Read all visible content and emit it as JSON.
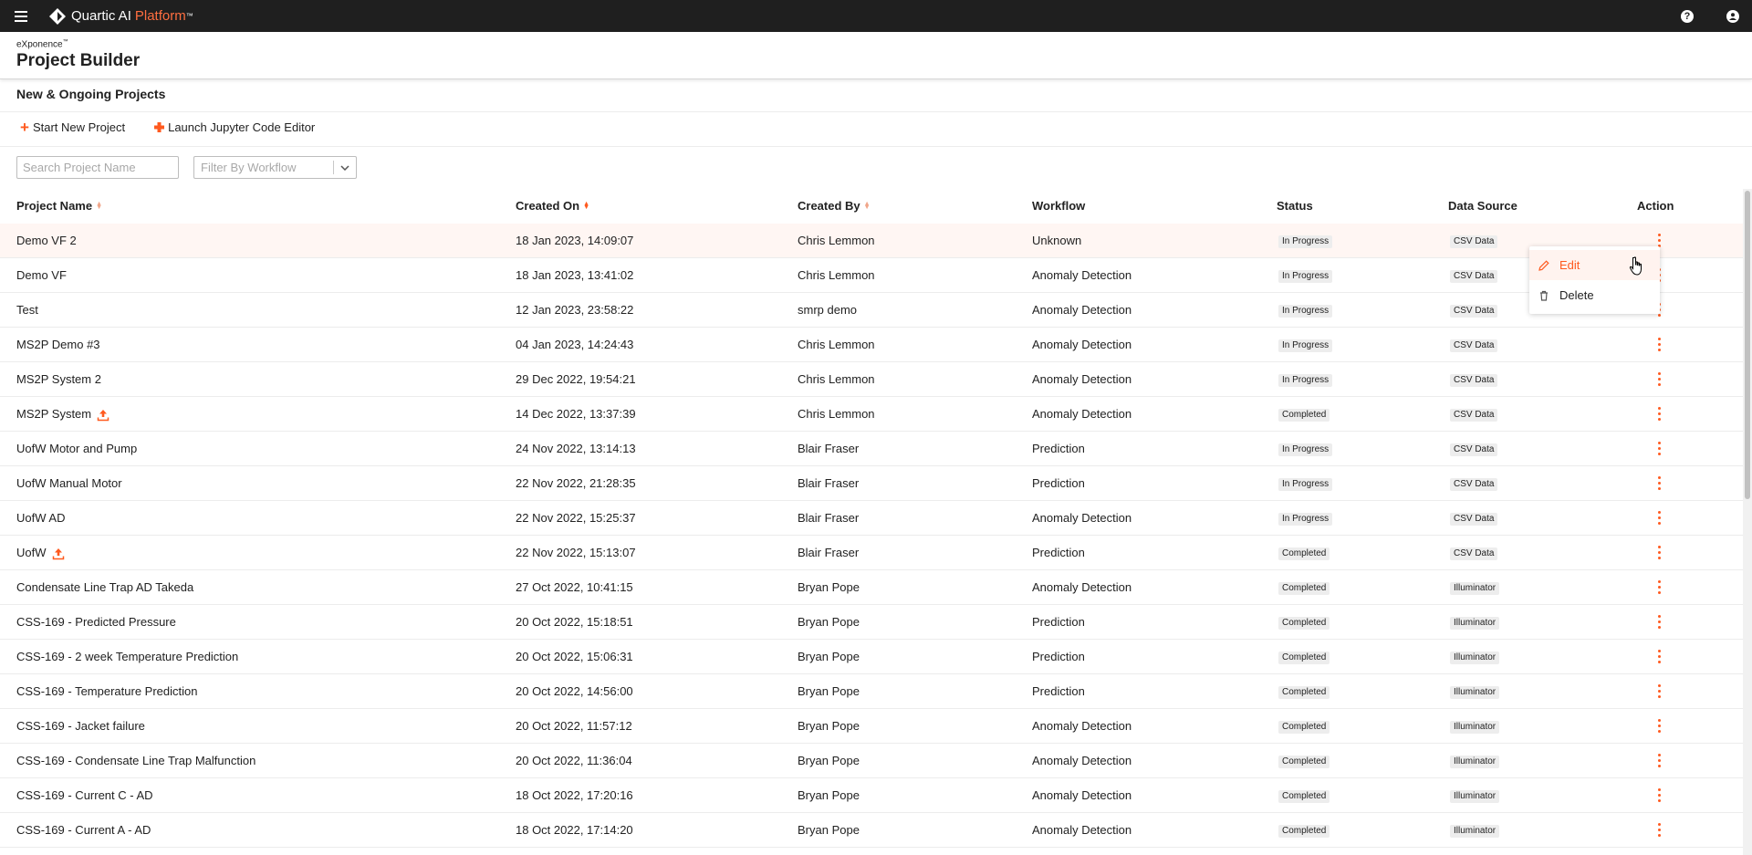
{
  "app": {
    "name": "Quartic AI",
    "name_accent": "Platform",
    "trademark": "™"
  },
  "header": {
    "brand": "eXponence",
    "brand_tm": "™",
    "title": "Project Builder"
  },
  "section_title": "New & Ongoing Projects",
  "actions": {
    "start_label": "Start New Project",
    "jupyter_label": "Launch Jupyter Code Editor"
  },
  "search": {
    "placeholder": "Search Project Name"
  },
  "filter": {
    "placeholder": "Filter By Workflow"
  },
  "columns": {
    "name": "Project Name",
    "created_on": "Created On",
    "created_by": "Created By",
    "workflow": "Workflow",
    "status": "Status",
    "source": "Data Source",
    "action": "Action"
  },
  "rows": [
    {
      "name": "Demo VF 2",
      "date": "18 Jan 2023, 14:09:07",
      "by": "Chris Lemmon",
      "workflow": "Unknown",
      "status": "In Progress",
      "source": "CSV Data"
    },
    {
      "name": "Demo VF",
      "date": "18 Jan 2023, 13:41:02",
      "by": "Chris Lemmon",
      "workflow": "Anomaly Detection",
      "status": "In Progress",
      "source": "CSV Data"
    },
    {
      "name": "Test",
      "date": "12 Jan 2023, 23:58:22",
      "by": "smrp demo",
      "workflow": "Anomaly Detection",
      "status": "In Progress",
      "source": "CSV Data"
    },
    {
      "name": "MS2P Demo #3",
      "date": "04 Jan 2023, 14:24:43",
      "by": "Chris Lemmon",
      "workflow": "Anomaly Detection",
      "status": "In Progress",
      "source": "CSV Data"
    },
    {
      "name": "MS2P System 2",
      "date": "29 Dec 2022, 19:54:21",
      "by": "Chris Lemmon",
      "workflow": "Anomaly Detection",
      "status": "In Progress",
      "source": "CSV Data"
    },
    {
      "name": "MS2P System",
      "date": "14 Dec 2022, 13:37:39",
      "by": "Chris Lemmon",
      "workflow": "Anomaly Detection",
      "status": "Completed",
      "source": "CSV Data"
    },
    {
      "name": "UofW Motor and Pump",
      "date": "24 Nov 2022, 13:14:13",
      "by": "Blair Fraser",
      "workflow": "Prediction",
      "status": "In Progress",
      "source": "CSV Data"
    },
    {
      "name": "UofW Manual Motor",
      "date": "22 Nov 2022, 21:28:35",
      "by": "Blair Fraser",
      "workflow": "Prediction",
      "status": "In Progress",
      "source": "CSV Data"
    },
    {
      "name": "UofW AD",
      "date": "22 Nov 2022, 15:25:37",
      "by": "Blair Fraser",
      "workflow": "Anomaly Detection",
      "status": "In Progress",
      "source": "CSV Data"
    },
    {
      "name": "UofW",
      "date": "22 Nov 2022, 15:13:07",
      "by": "Blair Fraser",
      "workflow": "Prediction",
      "status": "Completed",
      "source": "CSV Data"
    },
    {
      "name": "Condensate Line Trap AD Takeda",
      "date": "27 Oct 2022, 10:41:15",
      "by": "Bryan Pope",
      "workflow": "Anomaly Detection",
      "status": "Completed",
      "source": "Illuminator"
    },
    {
      "name": "CSS-169 - Predicted Pressure",
      "date": "20 Oct 2022, 15:18:51",
      "by": "Bryan Pope",
      "workflow": "Prediction",
      "status": "Completed",
      "source": "Illuminator"
    },
    {
      "name": "CSS-169 - 2 week Temperature Prediction",
      "date": "20 Oct 2022, 15:06:31",
      "by": "Bryan Pope",
      "workflow": "Prediction",
      "status": "Completed",
      "source": "Illuminator"
    },
    {
      "name": "CSS-169 - Temperature Prediction",
      "date": "20 Oct 2022, 14:56:00",
      "by": "Bryan Pope",
      "workflow": "Prediction",
      "status": "Completed",
      "source": "Illuminator"
    },
    {
      "name": "CSS-169 - Jacket failure",
      "date": "20 Oct 2022, 11:57:12",
      "by": "Bryan Pope",
      "workflow": "Anomaly Detection",
      "status": "Completed",
      "source": "Illuminator"
    },
    {
      "name": "CSS-169 - Condensate Line Trap Malfunction",
      "date": "20 Oct 2022, 11:36:04",
      "by": "Bryan Pope",
      "workflow": "Anomaly Detection",
      "status": "Completed",
      "source": "Illuminator"
    },
    {
      "name": "CSS-169 - Current C - AD",
      "date": "18 Oct 2022, 17:20:16",
      "by": "Bryan Pope",
      "workflow": "Anomaly Detection",
      "status": "Completed",
      "source": "Illuminator"
    },
    {
      "name": "CSS-169 - Current A - AD",
      "date": "18 Oct 2022, 17:14:20",
      "by": "Bryan Pope",
      "workflow": "Anomaly Detection",
      "status": "Completed",
      "source": "Illuminator"
    }
  ],
  "menu": {
    "edit_label": "Edit",
    "delete_label": "Delete"
  },
  "icons": {
    "menu": "hamburger-icon",
    "help": "help-icon",
    "account": "account-icon",
    "upload": "upload-icon",
    "edit": "pencil-icon",
    "delete": "trash-icon",
    "row_action": "kebab-icon"
  },
  "colors": {
    "accent": "#ff5a1f",
    "topbar": "#1f1f1f",
    "badge_bg": "#ededed"
  }
}
